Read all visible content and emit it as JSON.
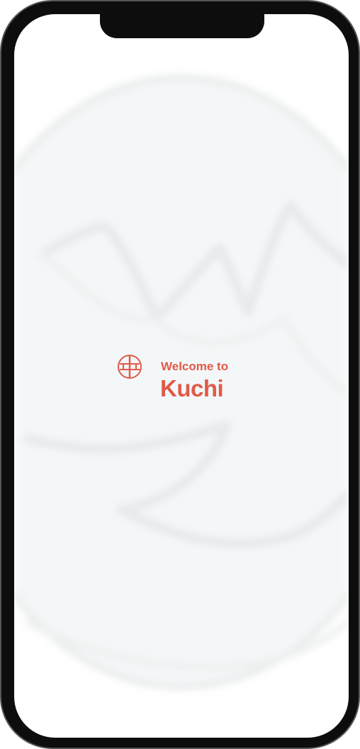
{
  "welcome": {
    "intro": "Welcome to",
    "app_name": "Kuchi"
  },
  "colors": {
    "accent": "#e05a49",
    "device_frame": "#0d0d0d",
    "screen_background": "#ffffff"
  },
  "icons": {
    "logo": "kuchi-logo-icon"
  }
}
